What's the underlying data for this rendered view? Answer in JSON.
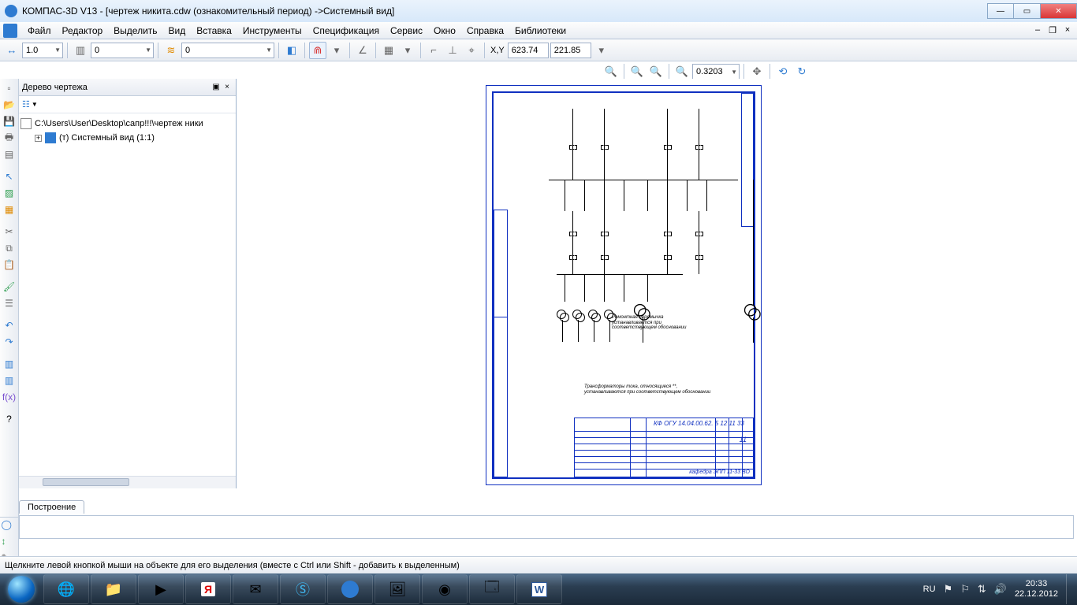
{
  "window": {
    "title": "КОМПАС-3D V13 - [чертеж никита.cdw (ознакомительный период) ->Системный вид]"
  },
  "menu": {
    "items": [
      "Файл",
      "Редактор",
      "Выделить",
      "Вид",
      "Вставка",
      "Инструменты",
      "Спецификация",
      "Сервис",
      "Окно",
      "Справка",
      "Библиотеки"
    ]
  },
  "toolbar1": {
    "step": "1.0",
    "pageCombo": "0",
    "styleCombo": "0",
    "xyLabel": "X,Y",
    "x": "623.74",
    "y": "221.85"
  },
  "viewtoolbar": {
    "zoom": "0.3203"
  },
  "tree": {
    "title": "Дерево чертежа",
    "filePath": "C:\\Users\\User\\Desktop\\сапр!!!\\чертеж ники",
    "viewNode": "(т) Системный вид (1:1)"
  },
  "drawing": {
    "note1a": "Ремонтная перемычка",
    "note1b": "устанавливается при",
    "note1c": "соответствующем обосновании",
    "note2a": "Трансформаторы тока, относящиеся **,",
    "note2b": "устанавливаются при соответствующем обосновании",
    "titleblock": {
      "code": "КФ ОГУ 14.04.00.62. 5 12 11 33",
      "num": "11",
      "dept": "кафедра ЭПП 11-33 ВО"
    }
  },
  "tabs": {
    "build": "Построение"
  },
  "status": {
    "hint": "Щелкните левой кнопкой мыши на объекте для его выделения (вместе с Ctrl или Shift - добавить к выделенным)"
  },
  "taskbar": {
    "lang": "RU",
    "time": "20:33",
    "date": "22.12.2012"
  }
}
